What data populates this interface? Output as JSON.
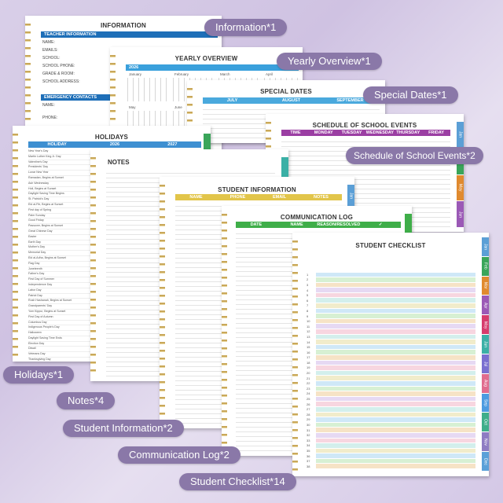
{
  "labels": {
    "information": "Information*1",
    "yearly_overview": "Yearly Overview*1",
    "special_dates": "Special Dates*1",
    "schedule": "Schedule of School Events*2",
    "holidays": "Holidays*1",
    "notes": "Notes*4",
    "student_information": "Student Information*2",
    "communication_log": "Communication Log*2",
    "student_checklist": "Student Checklist*14"
  },
  "information_page": {
    "title": "INFORMATION",
    "teacher_header": "TEACHER INFORMATION",
    "teacher_fields": [
      "NAME:",
      "EMAILS:",
      "SCHOOL:",
      "SCHOOL PHONE:",
      "GRADE & ROOM:",
      "SCHOOL ADDRESS:"
    ],
    "emergency_header": "EMERGENCY CONTACTS",
    "emergency_fields": [
      "NAME:",
      "PHONE:",
      "NAME:"
    ]
  },
  "yearly_page": {
    "title": "YEARLY OVERVIEW",
    "year": "2026",
    "months": [
      "January",
      "February",
      "March",
      "April",
      "May",
      "June"
    ]
  },
  "special_dates_page": {
    "title": "SPECIAL DATES",
    "columns": [
      "JULY",
      "AUGUST",
      "SEPTEMBER"
    ]
  },
  "schedule_page": {
    "title": "SCHEDULE OF SCHOOL EVENTS",
    "columns": [
      "TIME",
      "MONDAY",
      "TUESDAY",
      "WEDNESDAY",
      "THURSDAY",
      "FRIDAY"
    ],
    "tabs": [
      "Jan",
      "Apr",
      "May",
      "Jun"
    ]
  },
  "holidays_page": {
    "title": "HOLIDAYS",
    "columns": [
      "HOLIDAY",
      "2026",
      "2027"
    ],
    "items": [
      "New Year's Day",
      "Martin Luther King Jr. Day",
      "Valentine's Day",
      "Presidents' Day",
      "Lunar New Year",
      "Ramadan, Begins at Sunset",
      "Ash Wednesday",
      "Holi, Begins at Sunset",
      "Daylight Saving Time Begins",
      "St. Patrick's Day",
      "Eid al-Fitr, Begins at Sunset",
      "First day of Spring",
      "Palm Sunday",
      "Good Friday",
      "Passover, Begins at Sunset",
      "Great Chinese Day",
      "Easter",
      "Earth Day",
      "Mother's Day",
      "Memorial Day",
      "Eid al-Adha, Begins at Sunset",
      "Flag Day",
      "Juneteenth",
      "Father's Day",
      "First Day of Summer",
      "Independence Day",
      "Labor Day",
      "Patriot Day",
      "Rosh Hashanah, Begins at Sunset",
      "Grandparents' Day",
      "Yom Kippur, Begins at Sunset",
      "First Day of Autumn",
      "Columbus Day",
      "Indigenous People's Day",
      "Halloween",
      "Daylight Saving Time Ends",
      "Election Day",
      "Diwali",
      "Veterans Day",
      "Thanksgiving Day",
      "Hanukkah, Begins at Sunset",
      "First Day of Winter",
      "Christmas Day",
      "Kwanzaa Begins",
      "New Year's Eve"
    ]
  },
  "notes_page": {
    "title": "NOTES"
  },
  "student_info_page": {
    "title": "STUDENT INFORMATION",
    "columns": [
      "NAME",
      "PHONE",
      "EMAIL",
      "NOTES"
    ],
    "tabs": [
      "Jan"
    ]
  },
  "comm_log_page": {
    "title": "COMMUNICATION LOG",
    "columns": [
      "DATE",
      "NAME",
      "REASON/RESOLVED",
      "✓"
    ]
  },
  "checklist_page": {
    "title": "STUDENT CHECKLIST",
    "row_numbers": [
      "1",
      "2",
      "3",
      "4",
      "5",
      "6",
      "7",
      "8",
      "9",
      "10",
      "11",
      "12",
      "13",
      "14",
      "15",
      "16",
      "17",
      "18",
      "19",
      "20",
      "21",
      "22",
      "23",
      "24",
      "25",
      "26",
      "27",
      "28",
      "29",
      "30",
      "31",
      "32",
      "33",
      "34",
      "35",
      "36",
      "37",
      "38"
    ],
    "tabs": [
      "Jan",
      "Feb",
      "Mar",
      "Apr",
      "May",
      "Jun",
      "Jul",
      "Aug",
      "Sep",
      "Oct",
      "Nov",
      "Dec"
    ]
  },
  "colors": {
    "label_bg": "#8a78a8",
    "info_blue": "#1e6fb8",
    "yearly_blue": "#3aa0dc",
    "special_blue": "#4aa9dd",
    "schedule_purple": "#9b3ea3",
    "holiday_blue": "#3d8fd1",
    "student_yellow": "#e2c54a",
    "comm_green": "#3fae49",
    "tabs": [
      "#5b9fd6",
      "#3aa55a",
      "#e08a2f",
      "#9b59b6",
      "#d63c6c",
      "#3bb0a6",
      "#7a6fd0",
      "#e06c8e",
      "#4c9be0",
      "#3fae8a",
      "#8e7cc3",
      "#5aa0d8"
    ]
  }
}
